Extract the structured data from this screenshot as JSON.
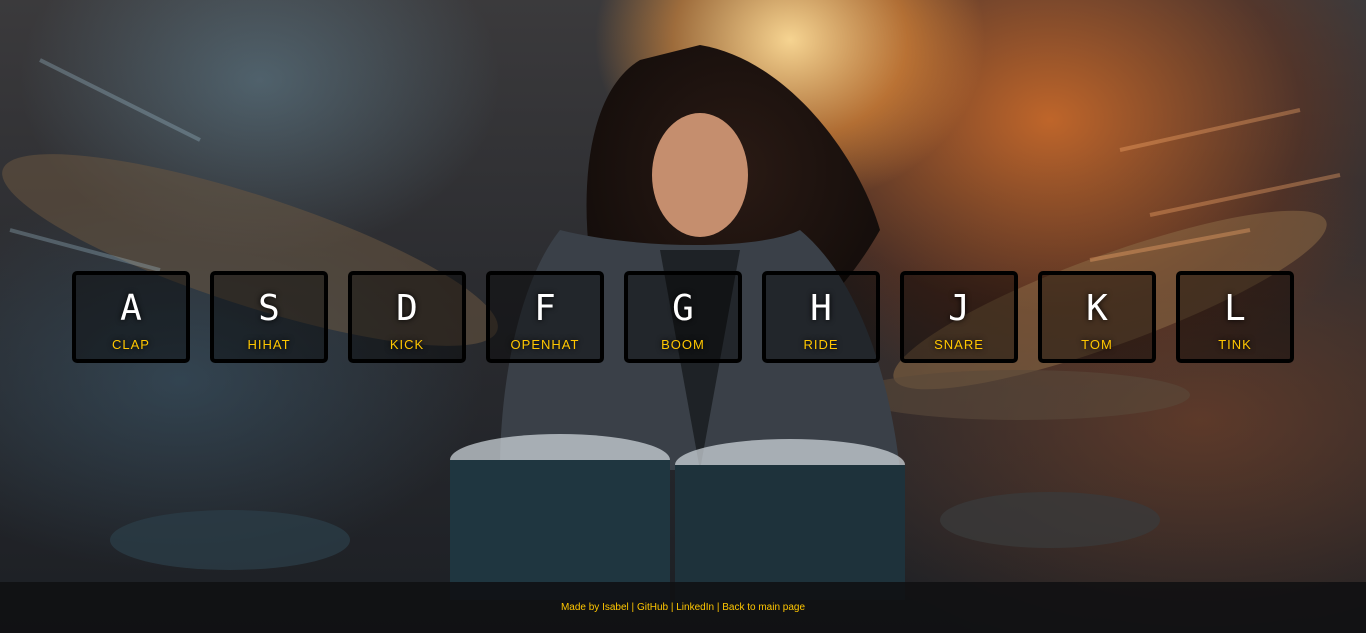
{
  "keys": [
    {
      "key": "A",
      "sound": "clap"
    },
    {
      "key": "S",
      "sound": "hihat"
    },
    {
      "key": "D",
      "sound": "kick"
    },
    {
      "key": "F",
      "sound": "openhat"
    },
    {
      "key": "G",
      "sound": "boom"
    },
    {
      "key": "H",
      "sound": "ride"
    },
    {
      "key": "J",
      "sound": "snare"
    },
    {
      "key": "K",
      "sound": "tom"
    },
    {
      "key": "L",
      "sound": "tink"
    }
  ],
  "footer": {
    "made_by": "Made by Isabel",
    "separator": "|",
    "github": "GitHub",
    "linkedin": "LinkedIn",
    "back": "Back to main page"
  }
}
